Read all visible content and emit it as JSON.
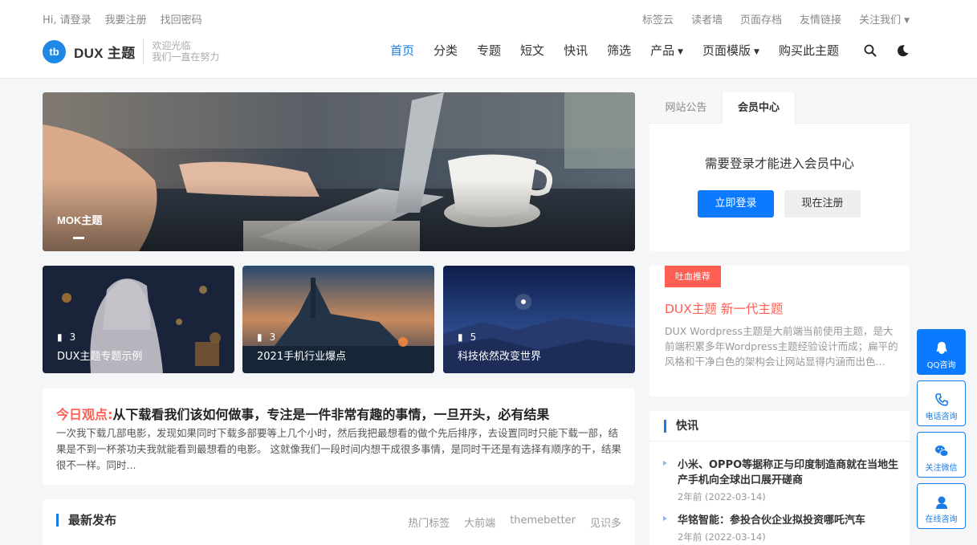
{
  "topbar": {
    "left_links": [
      "Hi, 请登录",
      "我要注册",
      "找回密码"
    ],
    "right_links": [
      "标签云",
      "读者墙",
      "页面存档",
      "友情链接",
      "关注我们"
    ]
  },
  "logo": {
    "mark": "tb",
    "name": "DUX 主题",
    "slogan_line1": "欢迎光临",
    "slogan_line2": "我们一直在努力"
  },
  "nav": {
    "items": [
      {
        "label": "首页",
        "active": true
      },
      {
        "label": "分类"
      },
      {
        "label": "专题"
      },
      {
        "label": "短文"
      },
      {
        "label": "快讯"
      },
      {
        "label": "筛选"
      },
      {
        "label": "产品",
        "dropdown": true
      },
      {
        "label": "页面模版",
        "dropdown": true
      },
      {
        "label": "购买此主题"
      }
    ]
  },
  "hero": {
    "title": "MOK主题"
  },
  "cards": [
    {
      "count": "3",
      "title": "DUX主题专题示例"
    },
    {
      "count": "3",
      "title": "2021手机行业爆点"
    },
    {
      "count": "5",
      "title": "科技依然改变世界"
    }
  ],
  "today": {
    "tag": "今日观点:",
    "title": "从下载看我们该如何做事，专注是一件非常有趣的事情，一旦开头，必有结果",
    "body": "一次我下载几部电影，发现如果同时下载多部要等上几个小时，然后我把最想看的做个先后排序，去设置同时只能下载一部，结果是不到一杯茶功夫我就能看到最想看的电影。 这就像我们一段时间内想干成很多事情，是同时干还是有选择有顺序的干，结果很不一样。同时..."
  },
  "latest": {
    "title": "最新发布",
    "links": [
      "热门标签",
      "大前端",
      "themebetter",
      "见识多"
    ]
  },
  "member": {
    "tabs": [
      "网站公告",
      "会员中心"
    ],
    "message": "需要登录才能进入会员中心",
    "login_label": "立即登录",
    "register_label": "现在注册"
  },
  "recommend": {
    "badge": "吐血推荐",
    "title": "DUX主题 新一代主题",
    "desc": "DUX Wordpress主题是大前端当前使用主题，是大前端积累多年Wordpress主题经验设计而成；扁平的风格和干净白色的架构会让网站显得内涵而出色..."
  },
  "news": {
    "title": "快讯",
    "items": [
      {
        "title": "小米、OPPO等据称正与印度制造商就在当地生产手机向全球出口展开磋商",
        "date": "2年前 (2022-03-14)"
      },
      {
        "title": "华铭智能：参投合伙企业拟投资哪吒汽车",
        "date": "2年前 (2022-03-14)"
      }
    ]
  },
  "float": [
    "QQ咨询",
    "电话咨询",
    "关注微信",
    "在线咨询"
  ],
  "colors": {
    "accent": "#1a7be5",
    "button": "#0b7aff",
    "hot": "#ff5e52"
  }
}
